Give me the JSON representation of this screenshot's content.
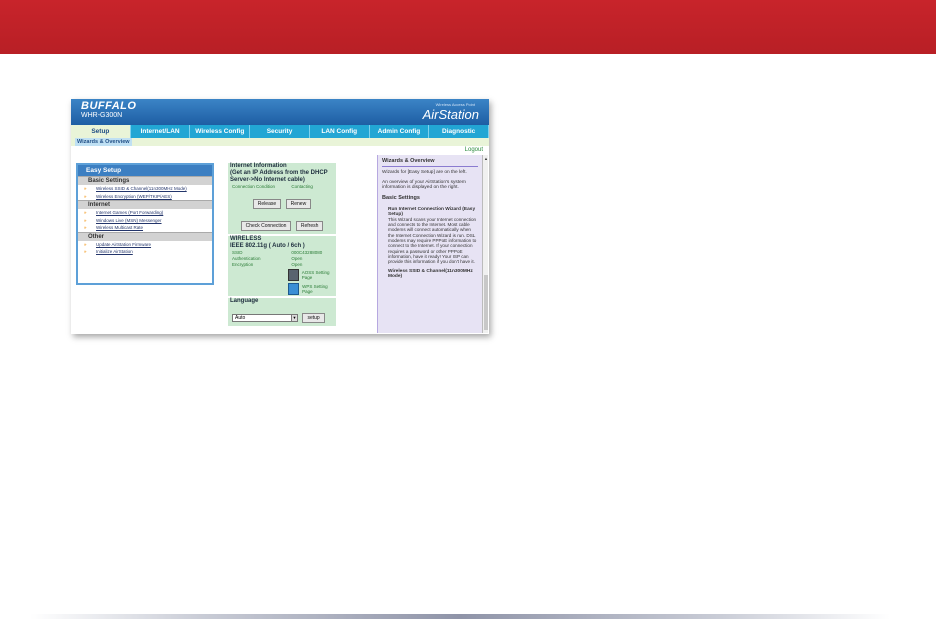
{
  "colors": {
    "top_bar": "#c8242b",
    "header": "#2a74b9",
    "tabs": "#22a6d4",
    "help_bg": "#e7e3f4",
    "panel_bg": "#cde9d2"
  },
  "header": {
    "brand": "BUFFALO",
    "model": "WHR-G300N",
    "product_line": "Wireless Access Point",
    "product_name": "AirStation"
  },
  "tabs": [
    "Setup",
    "Internet/LAN",
    "Wireless Config",
    "Security",
    "LAN Config",
    "Admin Config",
    "Diagnostic"
  ],
  "active_tab": "Setup",
  "subtab": "Wizards & Overview",
  "logout": "Logout",
  "easy_setup": {
    "title": "Easy Setup",
    "sections": [
      {
        "name": "Basic Settings",
        "items": [
          "Wireless SSID & Channel(11n300MHz Mode)",
          "Wireless Encryption (WEP/TKIP/AES)"
        ]
      },
      {
        "name": "Internet",
        "items": [
          "Internet Games (Port Forwarding)",
          "Windows Live (MSN) Messenger",
          "Wireless Multicast Rate"
        ]
      },
      {
        "name": "Other",
        "items": [
          "Update AirStation Firmware",
          "Initialize AirStation"
        ]
      }
    ]
  },
  "internet_info": {
    "title": "Internet Information",
    "subtitle": "(Get an IP Address from the DHCP Server->No Internet cable)",
    "condition_label": "Connection Condition",
    "condition_value": "Contacting",
    "buttons": [
      "Release",
      "Renew",
      "Check Connection",
      "Refresh"
    ]
  },
  "wireless": {
    "title": "WIRELESS",
    "mode": "IEEE 802.11g ( Auto / 6ch )",
    "rows": [
      {
        "k": "SSID",
        "v": "000C43288080"
      },
      {
        "k": "Authentication",
        "v": "Open"
      },
      {
        "k": "Encryption",
        "v": "Open"
      }
    ],
    "aoss_link": "AOSS Setting Page",
    "wps_link": "WPS Setting Page"
  },
  "language": {
    "title": "Language",
    "value": "Auto",
    "button": "setup"
  },
  "help": {
    "title": "Wizards & Overview",
    "p1": "Wizards for [Easy Setup] are on the left.",
    "p2": "An overview of your AirStation's system information is displayed on the right.",
    "h_basic": "Basic Settings",
    "h_wizard": "Run Internet Connection Wizard (Easy Setup)",
    "p_wizard": "This Wizard scans your Internet connection and connects to the Internet. Most cable modems will connect automatically when the Internet Connection Wizard is run. DSL modems may require PPPoE information to connect to the Internet. If your connection requires a password or other PPPoE information, have it ready! Your ISP can provide this information if you don't have it.",
    "h_ssid": "Wireless SSID & Channel(11n300MHz Mode)"
  }
}
